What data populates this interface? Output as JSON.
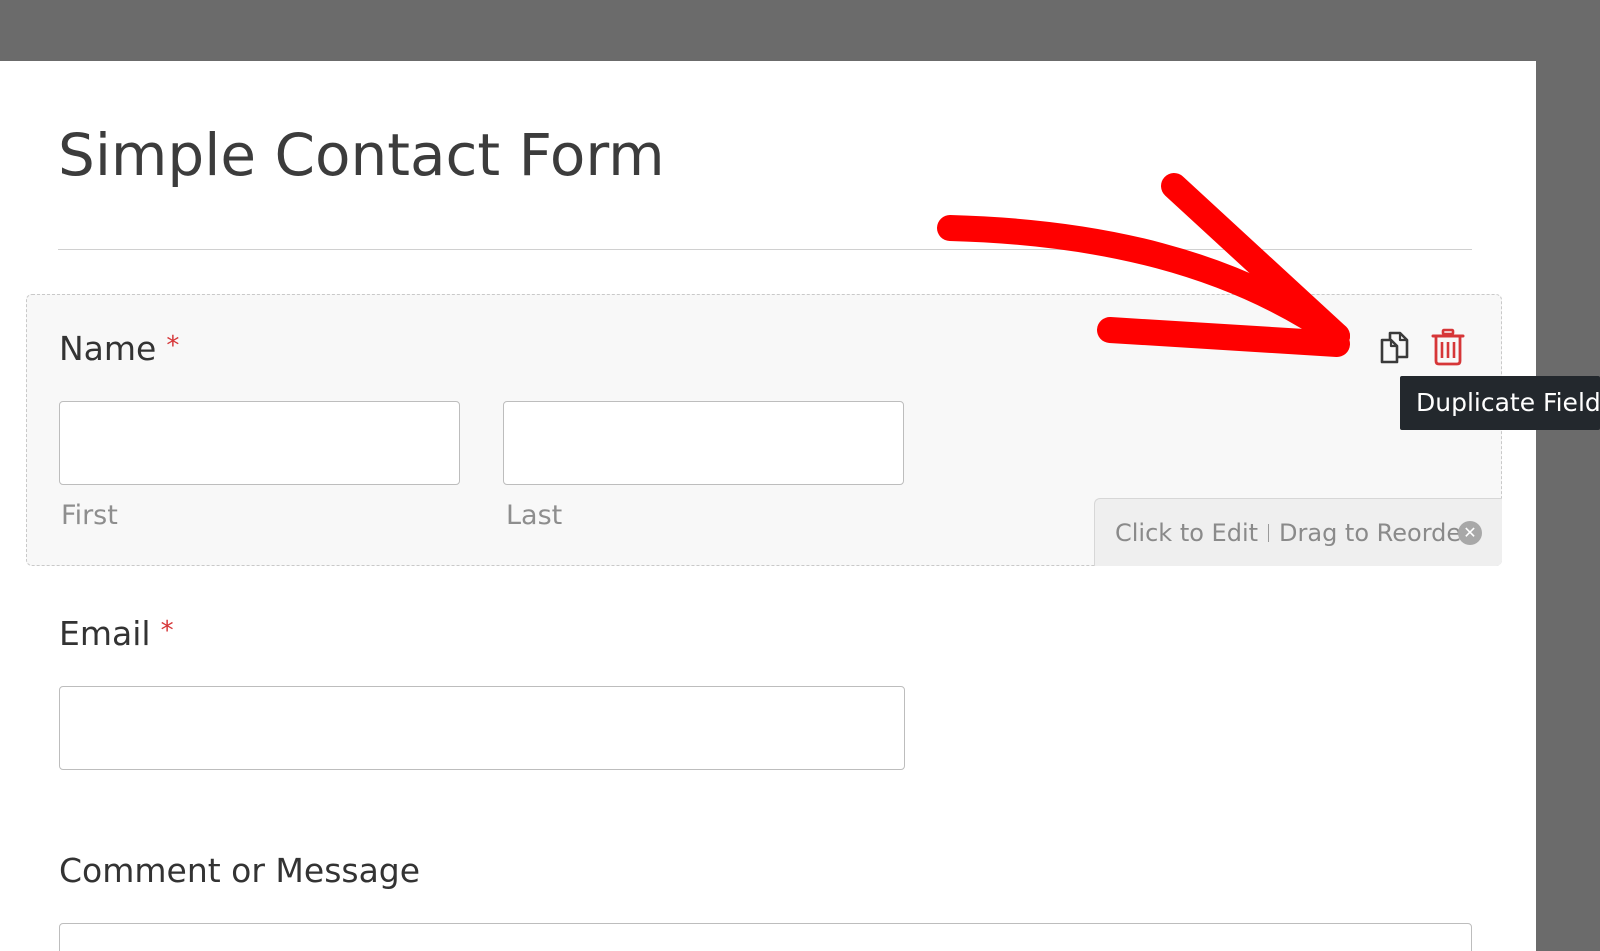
{
  "form": {
    "title": "Simple Contact Form",
    "fields": {
      "name": {
        "label": "Name",
        "required_mark": "*",
        "first_sublabel": "First",
        "last_sublabel": "Last",
        "first_value": "",
        "last_value": ""
      },
      "email": {
        "label": "Email",
        "required_mark": "*",
        "value": ""
      },
      "message": {
        "label": "Comment or Message",
        "value": ""
      }
    }
  },
  "field_actions": {
    "duplicate_icon": "duplicate-icon",
    "delete_icon": "trash-icon",
    "tooltip": "Duplicate Field"
  },
  "hint_bar": {
    "click_to_edit": "Click to Edit",
    "drag_to_reorder": "Drag to Reorder",
    "close_icon": "close-circle-icon"
  },
  "colors": {
    "accent_red": "#d63638",
    "annotation_red": "#ff0000",
    "tooltip_bg": "#23282d",
    "outer_bg": "#6b6b6b"
  }
}
